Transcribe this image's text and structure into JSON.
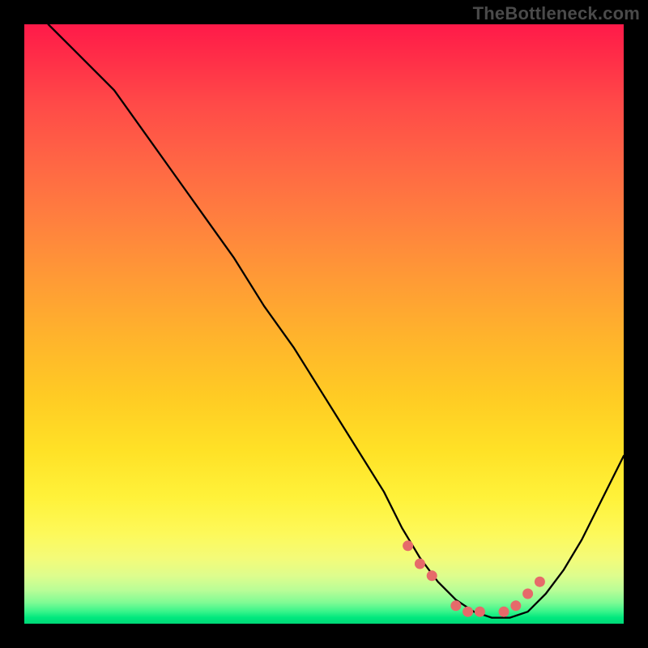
{
  "watermark": "TheBottleneck.com",
  "chart_data": {
    "type": "line",
    "title": "",
    "xlabel": "",
    "ylabel": "",
    "xlim": [
      0,
      100
    ],
    "ylim": [
      0,
      100
    ],
    "series": [
      {
        "name": "curve",
        "x": [
          4,
          8,
          12,
          15,
          20,
          25,
          30,
          35,
          40,
          45,
          50,
          55,
          60,
          63,
          66,
          69,
          72,
          75,
          78,
          81,
          84,
          87,
          90,
          93,
          96,
          100
        ],
        "y": [
          100,
          96,
          92,
          89,
          82,
          75,
          68,
          61,
          53,
          46,
          38,
          30,
          22,
          16,
          11,
          7,
          4,
          2,
          1,
          1,
          2,
          5,
          9,
          14,
          20,
          28
        ]
      }
    ],
    "markers": {
      "name": "highlight-points",
      "x": [
        64,
        66,
        68,
        72,
        74,
        76,
        80,
        82,
        84,
        86
      ],
      "y": [
        13,
        10,
        8,
        3,
        2,
        2,
        2,
        3,
        5,
        7
      ]
    },
    "colors": {
      "curve": "#000000",
      "markers": "#e66a6a",
      "gradient_top": "#ff1a49",
      "gradient_mid": "#ffe126",
      "gradient_bottom": "#00d877"
    }
  }
}
